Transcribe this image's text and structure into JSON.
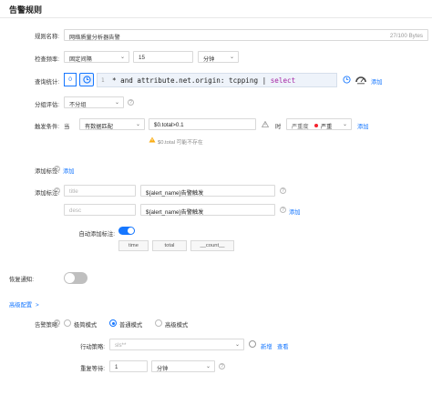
{
  "dialog": {
    "title": "告警规则"
  },
  "rule_name": {
    "label": "规则名称:",
    "value": "网络质量分析器告警",
    "counter": "27/100 Bytes"
  },
  "frequency": {
    "label": "检查频率:",
    "mode": "固定间隔",
    "value": "15",
    "unit": "分钟"
  },
  "query": {
    "label": "查询统计:",
    "index": "0",
    "line_no": "1",
    "code_prefix": "* and attribute.net.origin: tcpping | ",
    "code_keyword": "select",
    "add_label": "添加"
  },
  "grouping": {
    "label": "分组评估:",
    "value": "不分组"
  },
  "trigger": {
    "label": "触发条件:",
    "when": "当",
    "match": "有数据匹配",
    "expr": "$0.total>0.1",
    "then": "时",
    "severity_label": "严重度",
    "severity_value": "严重",
    "add_label": "添加",
    "warning": "$0.total 可能不存在",
    "severity_color": "#f5222d"
  },
  "tags": {
    "label": "添加标签:",
    "add_label": "添加"
  },
  "annotations": {
    "label": "添加标注:",
    "rows": [
      {
        "key_placeholder": "title",
        "value": "${alert_name}告警触发"
      },
      {
        "key_placeholder": "desc",
        "value": "${alert_name}告警触发"
      }
    ],
    "add_label": "添加",
    "auto_label": "自动添加标注:",
    "auto_tags": [
      "time",
      "total",
      "__count__"
    ]
  },
  "recovery": {
    "label": "恢复通知:"
  },
  "advanced": {
    "label": "高级配置",
    "chevron": ">"
  },
  "alert_policy": {
    "label": "告警策略:",
    "options": [
      "极简模式",
      "普通模式",
      "高级模式"
    ],
    "selected": "普通模式"
  },
  "action_policy": {
    "label": "行动策略:",
    "value": "sls**",
    "new_label": "新增",
    "view_label": "查看"
  },
  "repeat": {
    "label": "重复等待:",
    "value": "1",
    "unit": "分钟"
  },
  "colors": {
    "accent": "#1677ff",
    "warning": "#faad14",
    "danger": "#f5222d"
  }
}
